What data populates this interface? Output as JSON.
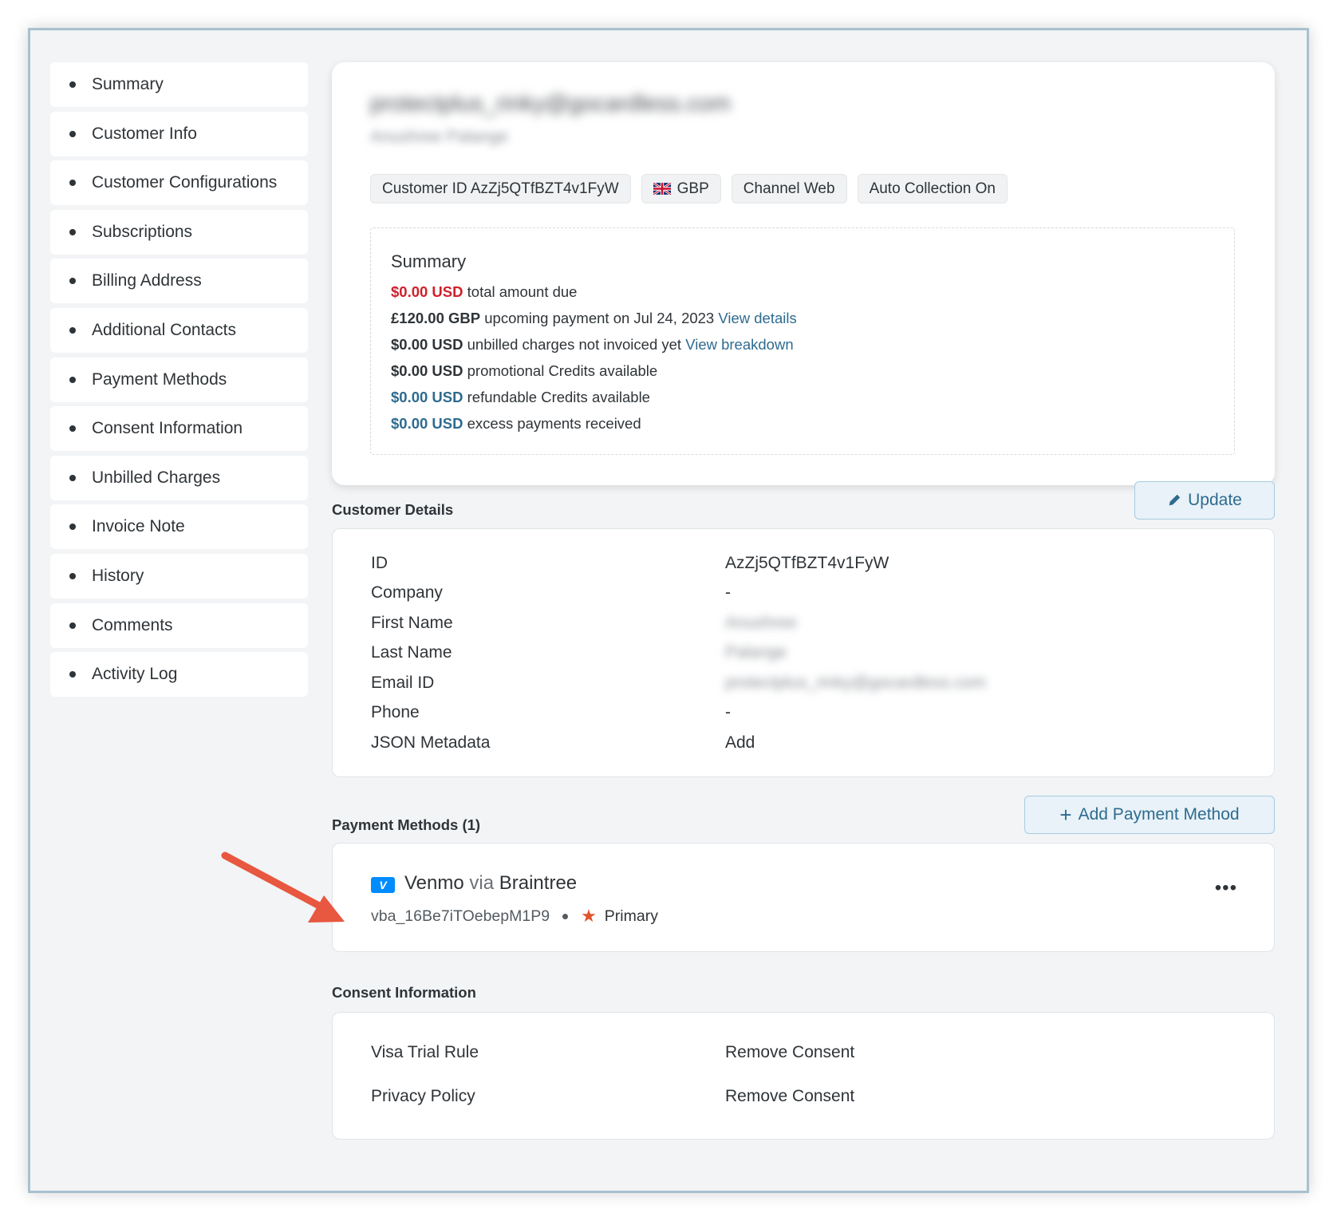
{
  "sidebar": {
    "items": [
      {
        "label": "Summary"
      },
      {
        "label": "Customer Info"
      },
      {
        "label": "Customer Configurations"
      },
      {
        "label": "Subscriptions"
      },
      {
        "label": "Billing Address"
      },
      {
        "label": "Additional Contacts"
      },
      {
        "label": "Payment Methods"
      },
      {
        "label": "Consent Information"
      },
      {
        "label": "Unbilled Charges"
      },
      {
        "label": "Invoice Note"
      },
      {
        "label": "History"
      },
      {
        "label": "Comments"
      },
      {
        "label": "Activity Log"
      }
    ]
  },
  "header": {
    "customer_email": "protectplus_rinky@gocardless.com",
    "customer_name": "Anushree Palange",
    "chips": {
      "customer_id": "Customer ID AzZj5QTfBZT4v1FyW",
      "currency": "GBP",
      "channel": "Channel Web",
      "auto_collection": "Auto Collection On"
    }
  },
  "summary": {
    "title": "Summary",
    "lines": [
      {
        "amount": "$0.00 USD",
        "text": " total amount due",
        "link": ""
      },
      {
        "amount": "£120.00 GBP",
        "text": " upcoming payment on Jul 24, 2023 ",
        "link": "View details"
      },
      {
        "amount": "$0.00 USD",
        "text": " unbilled charges not invoiced yet ",
        "link": "View breakdown"
      },
      {
        "amount": "$0.00 USD",
        "text": " promotional Credits available",
        "link": ""
      },
      {
        "amount": "$0.00 USD",
        "text": " refundable Credits available",
        "link": ""
      },
      {
        "amount": "$0.00 USD",
        "text": " excess payments received",
        "link": ""
      }
    ]
  },
  "customer_details": {
    "title": "Customer Details",
    "update_label": "Update",
    "rows": [
      {
        "label": "ID",
        "value": "AzZj5QTfBZT4v1FyW"
      },
      {
        "label": "Company",
        "value": "-"
      },
      {
        "label": "First Name",
        "value": "Anushree"
      },
      {
        "label": "Last Name",
        "value": "Palange"
      },
      {
        "label": "Email ID",
        "value": "protectplus_rinky@gocardless.com"
      },
      {
        "label": "Phone",
        "value": "-"
      },
      {
        "label": "JSON Metadata",
        "value": "Add"
      }
    ]
  },
  "payment_methods": {
    "title": "Payment Methods (1)",
    "add_label": "Add Payment Method",
    "method": {
      "badge": "V",
      "name": "Venmo",
      "via": "via",
      "gateway": "Braintree",
      "reference": "vba_16Be7iTOebepM1P9",
      "status": "Primary",
      "more": "•••"
    }
  },
  "consent": {
    "title": "Consent Information",
    "rows": [
      {
        "label": "Visa Trial Rule",
        "action": "Remove Consent"
      },
      {
        "label": "Privacy Policy",
        "action": "Remove Consent"
      }
    ]
  },
  "colors": {
    "accent": "#2f6b8f",
    "due_red": "#d0202c",
    "arrow": "#e8573f",
    "venmo_blue": "#008cff",
    "star": "#e0542b"
  }
}
